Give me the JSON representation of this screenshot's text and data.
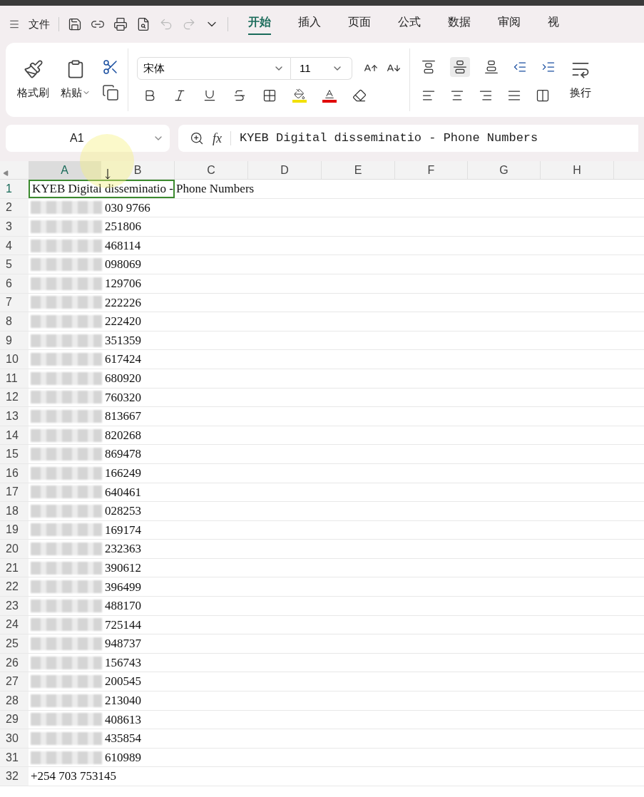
{
  "menu": {
    "file": "文件"
  },
  "tabs": [
    {
      "label": "开始",
      "selected": true
    },
    {
      "label": "插入",
      "selected": false
    },
    {
      "label": "页面",
      "selected": false
    },
    {
      "label": "公式",
      "selected": false
    },
    {
      "label": "数据",
      "selected": false
    },
    {
      "label": "审阅",
      "selected": false
    },
    {
      "label": "视",
      "selected": false
    }
  ],
  "ribbon": {
    "format_painter": "格式刷",
    "paste": "粘贴",
    "font": "宋体",
    "font_size": "11",
    "wrap": "换行"
  },
  "name_box": "A1",
  "fx_label": "fx",
  "formula": "KYEB Digital disseminatio - Phone Numbers",
  "columns": [
    "A",
    "B",
    "C",
    "D",
    "E",
    "F",
    "G",
    "H"
  ],
  "rows": [
    {
      "number": "1",
      "text": "KYEB Digital disseminatio - Phone Numbers",
      "redacted": false
    },
    {
      "number": "2",
      "text": "030 9766",
      "redacted": true
    },
    {
      "number": "3",
      "text": "251806",
      "redacted": true
    },
    {
      "number": "4",
      "text": "468114",
      "redacted": true
    },
    {
      "number": "5",
      "text": "098069",
      "redacted": true
    },
    {
      "number": "6",
      "text": "129706",
      "redacted": true
    },
    {
      "number": "7",
      "text": "222226",
      "redacted": true
    },
    {
      "number": "8",
      "text": "222420",
      "redacted": true
    },
    {
      "number": "9",
      "text": "351359",
      "redacted": true
    },
    {
      "number": "10",
      "text": "617424",
      "redacted": true
    },
    {
      "number": "11",
      "text": "680920",
      "redacted": true
    },
    {
      "number": "12",
      "text": "760320",
      "redacted": true
    },
    {
      "number": "13",
      "text": "813667",
      "redacted": true
    },
    {
      "number": "14",
      "text": "820268",
      "redacted": true
    },
    {
      "number": "15",
      "text": "869478",
      "redacted": true
    },
    {
      "number": "16",
      "text": "166249",
      "redacted": true
    },
    {
      "number": "17",
      "text": "640461",
      "redacted": true
    },
    {
      "number": "18",
      "text": "028253",
      "redacted": true
    },
    {
      "number": "19",
      "text": "169174",
      "redacted": true
    },
    {
      "number": "20",
      "text": "232363",
      "redacted": true
    },
    {
      "number": "21",
      "text": "390612",
      "redacted": true
    },
    {
      "number": "22",
      "text": "396499",
      "redacted": true
    },
    {
      "number": "23",
      "text": "488170",
      "redacted": true
    },
    {
      "number": "24",
      "text": "725144",
      "redacted": true
    },
    {
      "number": "25",
      "text": "948737",
      "redacted": true
    },
    {
      "number": "26",
      "text": "156743",
      "redacted": true
    },
    {
      "number": "27",
      "text": "200545",
      "redacted": true
    },
    {
      "number": "28",
      "text": "213040",
      "redacted": true
    },
    {
      "number": "29",
      "text": "408613",
      "redacted": true
    },
    {
      "number": "30",
      "text": "435854",
      "redacted": true
    },
    {
      "number": "31",
      "text": "610989",
      "redacted": true
    },
    {
      "number": "32",
      "text": "+254 703 753145",
      "redacted": false
    }
  ]
}
